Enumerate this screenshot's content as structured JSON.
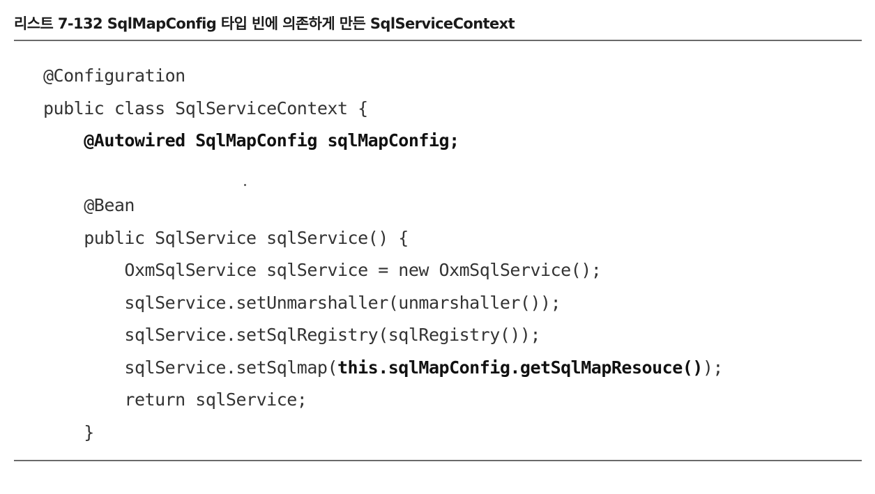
{
  "caption": "리스트 7-132 SqlMapConfig 타입 빈에 의존하게 만든 SqlServiceContext",
  "code": {
    "l1": "@Configuration",
    "l2": "public class SqlServiceContext {",
    "l3": "@Autowired SqlMapConfig sqlMapConfig;",
    "l4": "",
    "l5": "@Bean",
    "l6": "public SqlService sqlService() {",
    "l7": "OxmSqlService sqlService = new OxmSqlService();",
    "l8": "sqlService.setUnmarshaller(unmarshaller());",
    "l9": "sqlService.setSqlRegistry(sqlRegistry());",
    "l10_a": "sqlService.setSqlmap(",
    "l10_b": "this.sqlMapConfig.getSqlMapResouce()",
    "l10_c": ");",
    "l11": "return sqlService;",
    "l12": "}"
  }
}
